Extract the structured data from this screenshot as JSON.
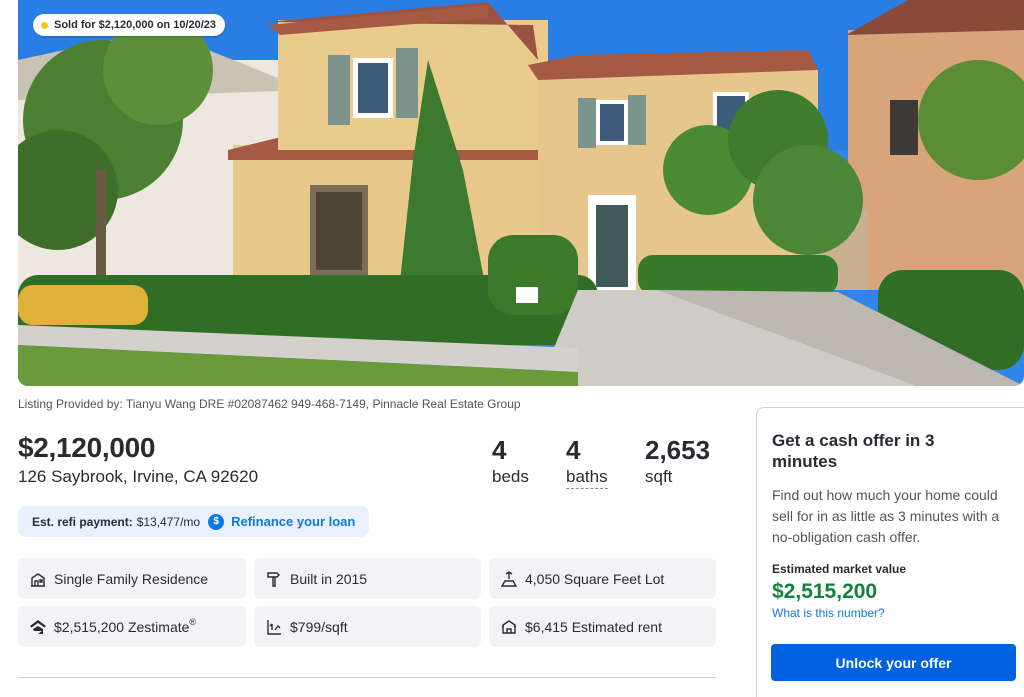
{
  "photo": {
    "sold_badge": "Sold for $2,120,000 on 10/20/23"
  },
  "listing": {
    "provided_by": "Listing Provided by: Tianyu Wang DRE #02087462 949-468-7149, Pinnacle Real Estate Group",
    "price": "$2,120,000",
    "address": "126 Saybrook, Irvine, CA 92620",
    "beds_value": "4",
    "beds_label": "beds",
    "baths_value": "4",
    "baths_label": "baths",
    "sqft_value": "2,653",
    "sqft_label": "sqft"
  },
  "refi": {
    "label": "Est. refi payment:",
    "value": "$13,477/mo",
    "icon": "$",
    "link": "Refinance your loan"
  },
  "facts": [
    {
      "icon": "home-type-icon",
      "text": "Single Family Residence"
    },
    {
      "icon": "hammer-icon",
      "text": "Built in 2015"
    },
    {
      "icon": "lot-icon",
      "text": "4,050 Square Feet Lot"
    },
    {
      "icon": "zestimate-icon",
      "text": "$2,515,200 Zestimate",
      "sup": "®"
    },
    {
      "icon": "price-per-sqft-icon",
      "text": "$799/sqft"
    },
    {
      "icon": "rent-icon",
      "text": "$6,415 Estimated rent"
    }
  ],
  "cash_offer": {
    "title": "Get a cash offer in 3 minutes",
    "description": "Find out how much your home could sell for in as little as 3 minutes with a no-obligation cash offer.",
    "market_value_label": "Estimated market value",
    "market_value": "$2,515,200",
    "what_link": "What is this number?",
    "button": "Unlock your offer"
  },
  "colors": {
    "accent_blue": "#1277e1",
    "button_blue": "#0062e0",
    "value_green": "#11823b",
    "sold_dot": "#f5c518"
  }
}
